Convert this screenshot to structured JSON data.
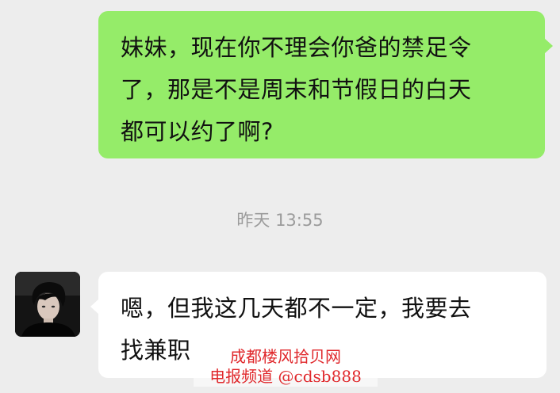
{
  "messages": {
    "outgoing": {
      "text": "妹妹，现在你不理会你爸的禁足令\n了，那是不是周末和节假日的白天\n都可以约了啊?"
    },
    "timestamp": "昨天 13:55",
    "incoming": {
      "avatar_icon": "person-portrait-avatar",
      "text": "嗯，但我这几天都不一定，我要去\n找兼职"
    }
  },
  "watermark": {
    "line1": "成都楼风拾贝网",
    "line2": "电报频道 @cdsb888"
  },
  "colors": {
    "background": "#ededed",
    "outgoing_bubble": "#95ec69",
    "incoming_bubble": "#ffffff",
    "timestamp_text": "#9b9b9b",
    "watermark_text": "#e0282c"
  }
}
